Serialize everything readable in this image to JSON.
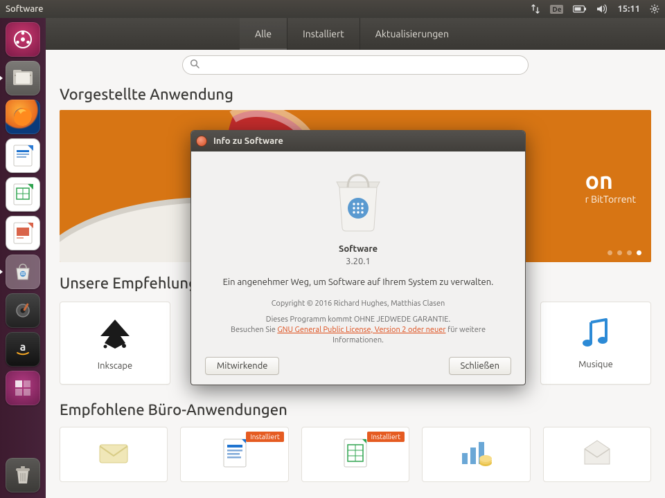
{
  "menubar": {
    "title": "Software",
    "lang": "De",
    "time": "15:11"
  },
  "launcher": {
    "items": [
      "dash",
      "files",
      "firefox",
      "writer",
      "calc",
      "impress",
      "software",
      "settings",
      "amazon",
      "workspaces"
    ],
    "trash": "trash"
  },
  "toolbar": {
    "tabs": {
      "all": "Alle",
      "installed": "Installiert",
      "updates": "Aktualisierungen"
    }
  },
  "search": {
    "placeholder": ""
  },
  "sections": {
    "featured": "Vorgestellte Anwendung",
    "recs": "Unsere Empfehlungen",
    "office": "Empfohlene Büro-Anwendungen"
  },
  "banner": {
    "title_suffix": "on",
    "subtitle_suffix": "r BitTorrent"
  },
  "recs_items": [
    {
      "name": "Inkscape"
    },
    {
      "name": "Musique"
    }
  ],
  "badge": {
    "installed": "Installiert"
  },
  "dialog": {
    "title": "Info zu Software",
    "name": "Software",
    "version": "3.20.1",
    "description": "Ein angenehmer Weg, um Software auf Ihrem System zu verwalten.",
    "copyright": "Copyright © 2016 Richard Hughes, Matthias Clasen",
    "warranty_pre": "Dieses Programm kommt OHNE JEDWEDE GARANTIE.",
    "warranty_visit": "Besuchen Sie ",
    "license_link": "GNU General Public License, Version 2 oder neuer",
    "warranty_post": " für weitere Informationen.",
    "credits_btn": "Mitwirkende",
    "close_btn": "Schließen"
  },
  "colors": {
    "accent": "#dd4814"
  }
}
